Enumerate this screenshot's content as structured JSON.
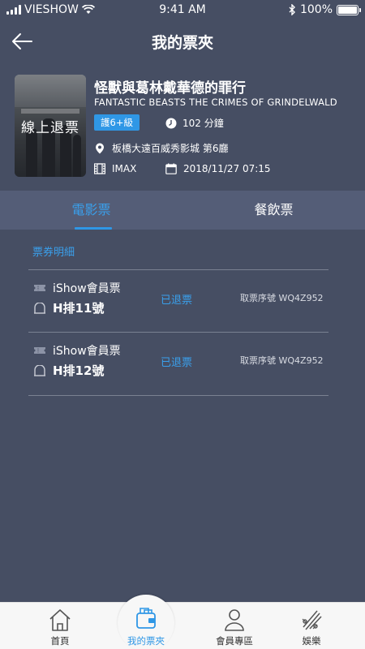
{
  "status_bar": {
    "carrier": "VIESHOW",
    "time": "9:41 AM",
    "battery": "100%"
  },
  "header": {
    "title": "我的票夾",
    "back_icon": "back-arrow-icon"
  },
  "movie": {
    "title": "怪獸與葛林戴華德的罪行",
    "title_en": "FANTASTIC BEASTS THE CRIMES OF GRINDELWALD",
    "poster_overlay": "線上退票",
    "rating": "護6+級",
    "duration": "102 分鐘",
    "location": "板橋大遠百威秀影城  第6廳",
    "format": "IMAX",
    "datetime": "2018/11/27 07:15"
  },
  "tabs": [
    {
      "label": "電影票",
      "active": true
    },
    {
      "label": "餐飲票",
      "active": false
    }
  ],
  "section_label": "票券明細",
  "tickets": [
    {
      "type": "iShow會員票",
      "seat": "H排11號",
      "status": "已退票",
      "code": "取票序號 WQ4Z952"
    },
    {
      "type": "iShow會員票",
      "seat": "H排12號",
      "status": "已退票",
      "code": "取票序號 WQ4Z952"
    }
  ],
  "bottom_nav": [
    {
      "label": "首頁",
      "icon": "home-icon"
    },
    {
      "label": "我的票夾",
      "icon": "wallet-icon",
      "active": true
    },
    {
      "label": "會員專區",
      "icon": "person-icon"
    },
    {
      "label": "娛樂",
      "icon": "entertainment-icon"
    }
  ],
  "colors": {
    "background": "#464e63",
    "tab_bar": "#545d77",
    "accent": "#2f97e6",
    "nav_bg": "#f7f7f7"
  }
}
